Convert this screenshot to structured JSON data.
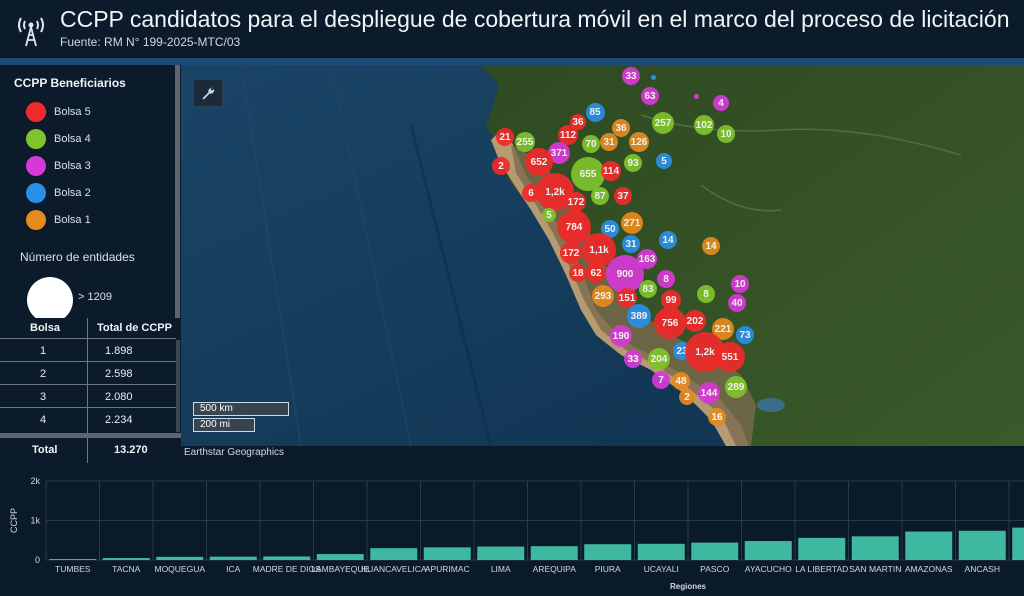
{
  "header": {
    "title": "CCPP candidatos para el despliegue de cobertura móvil en el marco del proceso de licitación",
    "subtitle": "Fuente: RM N° 199-2025-MTC/03",
    "logo_icon": "antenna-tower-icon"
  },
  "legend": {
    "title": "CCPP Beneficiarios",
    "items": [
      {
        "label": "Bolsa 5",
        "color": "#f02a2a"
      },
      {
        "label": "Bolsa 4",
        "color": "#7fc42a"
      },
      {
        "label": "Bolsa 3",
        "color": "#d63ad6"
      },
      {
        "label": "Bolsa 2",
        "color": "#2a8fe6"
      },
      {
        "label": "Bolsa 1",
        "color": "#e68a1e"
      }
    ],
    "size_title": "Número de entidades",
    "size_label": "> 1209"
  },
  "table": {
    "headers": [
      "Bolsa",
      "Total de CCPP"
    ],
    "rows": [
      [
        "1",
        "1.898"
      ],
      [
        "2",
        "2.598"
      ],
      [
        "3",
        "2.080"
      ],
      [
        "4",
        "2.234"
      ]
    ],
    "total_label": "Total",
    "total_value": "13.270"
  },
  "map": {
    "tool_icon": "wrench-icon",
    "scale_km": "500 km",
    "scale_mi": "200 mi",
    "attribution": "Earthstar Geographics",
    "clusters": [
      {
        "label": "33",
        "bolsa": 3
      },
      {
        "label": "63",
        "bolsa": 3
      },
      {
        "label": "4",
        "bolsa": 3
      },
      {
        "label": "85",
        "bolsa": 2
      },
      {
        "label": "36",
        "bolsa": 5
      },
      {
        "label": "36",
        "bolsa": 1
      },
      {
        "label": "257",
        "bolsa": 4
      },
      {
        "label": "102",
        "bolsa": 4
      },
      {
        "label": "10",
        "bolsa": 4
      },
      {
        "label": "21",
        "bolsa": 5
      },
      {
        "label": "255",
        "bolsa": 4
      },
      {
        "label": "112",
        "bolsa": 5
      },
      {
        "label": "70",
        "bolsa": 4
      },
      {
        "label": "31",
        "bolsa": 1
      },
      {
        "label": "126",
        "bolsa": 1
      },
      {
        "label": "371",
        "bolsa": 3
      },
      {
        "label": "652",
        "bolsa": 5
      },
      {
        "label": "2",
        "bolsa": 5
      },
      {
        "label": "93",
        "bolsa": 4
      },
      {
        "label": "5",
        "bolsa": 2
      },
      {
        "label": "655",
        "bolsa": 4
      },
      {
        "label": "114",
        "bolsa": 5
      },
      {
        "label": "6",
        "bolsa": 5
      },
      {
        "label": "1,2k",
        "bolsa": 5
      },
      {
        "label": "172",
        "bolsa": 5
      },
      {
        "label": "87",
        "bolsa": 4
      },
      {
        "label": "37",
        "bolsa": 5
      },
      {
        "label": "5",
        "bolsa": 4
      },
      {
        "label": "784",
        "bolsa": 5
      },
      {
        "label": "271",
        "bolsa": 1
      },
      {
        "label": "50",
        "bolsa": 2
      },
      {
        "label": "31",
        "bolsa": 2
      },
      {
        "label": "14",
        "bolsa": 2
      },
      {
        "label": "14",
        "bolsa": 1
      },
      {
        "label": "172",
        "bolsa": 5
      },
      {
        "label": "1,1k",
        "bolsa": 5
      },
      {
        "label": "163",
        "bolsa": 3
      },
      {
        "label": "900",
        "bolsa": 3
      },
      {
        "label": "18",
        "bolsa": 5
      },
      {
        "label": "62",
        "bolsa": 5
      },
      {
        "label": "8",
        "bolsa": 3
      },
      {
        "label": "83",
        "bolsa": 4
      },
      {
        "label": "10",
        "bolsa": 3
      },
      {
        "label": "293",
        "bolsa": 1
      },
      {
        "label": "151",
        "bolsa": 5
      },
      {
        "label": "99",
        "bolsa": 5
      },
      {
        "label": "8",
        "bolsa": 4
      },
      {
        "label": "40",
        "bolsa": 3
      },
      {
        "label": "389",
        "bolsa": 2
      },
      {
        "label": "756",
        "bolsa": 5
      },
      {
        "label": "202",
        "bolsa": 5
      },
      {
        "label": "221",
        "bolsa": 1
      },
      {
        "label": "190",
        "bolsa": 3
      },
      {
        "label": "73",
        "bolsa": 2
      },
      {
        "label": "23",
        "bolsa": 2
      },
      {
        "label": "1,2k",
        "bolsa": 5
      },
      {
        "label": "551",
        "bolsa": 5
      },
      {
        "label": "33",
        "bolsa": 3
      },
      {
        "label": "204",
        "bolsa": 4
      },
      {
        "label": "7",
        "bolsa": 3
      },
      {
        "label": "48",
        "bolsa": 1
      },
      {
        "label": "289",
        "bolsa": 4
      },
      {
        "label": "144",
        "bolsa": 3
      },
      {
        "label": "2",
        "bolsa": 1
      },
      {
        "label": "16",
        "bolsa": 1
      }
    ]
  },
  "chart_data": {
    "type": "bar",
    "xlabel": "Regiones",
    "ylabel": "CCPP",
    "yticks": [
      "0",
      "1k",
      "2k"
    ],
    "ylim": [
      0,
      2000
    ],
    "bar_color": "#3fb8a0",
    "categories": [
      "TUMBES",
      "TACNA",
      "MOQUEGUA",
      "ICA",
      "MADRE DE DIOS",
      "LAMBAYEQUE",
      "HUANCAVELICA",
      "APURIMAC",
      "LIMA",
      "AREQUIPA",
      "PIURA",
      "UCAYALI",
      "PASCO",
      "AYACUCHO",
      "LA LIBERTAD",
      "SAN MARTIN",
      "AMAZONAS",
      "ANCASH",
      "HU"
    ],
    "values": [
      25,
      50,
      80,
      85,
      90,
      150,
      300,
      320,
      340,
      350,
      400,
      410,
      440,
      480,
      560,
      600,
      720,
      740,
      820
    ]
  }
}
